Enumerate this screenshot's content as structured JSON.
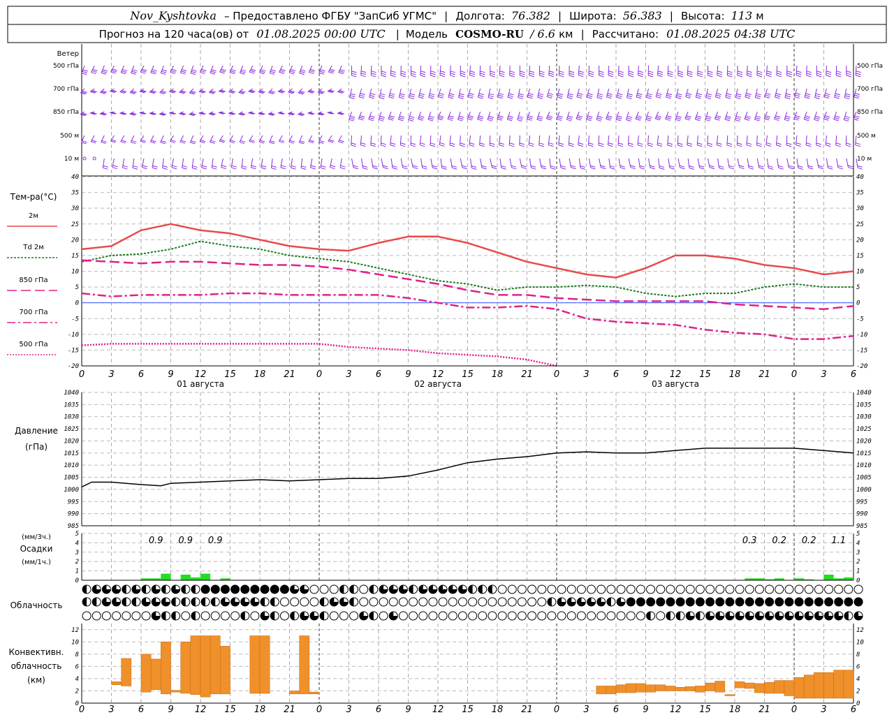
{
  "header": {
    "station": "Nov_Kyshtovka",
    "provider": "– Предоставлено ФГБУ \"ЗапСиб УГМС\"",
    "lon_label": "Долгота:",
    "lon_value": "76.382",
    "lat_label": "Широта:",
    "lat_value": "56.383",
    "alt_label": "Высота:",
    "alt_value": "113",
    "alt_unit": "м",
    "forecast_prefix": "Прогноз на 120 часа(ов) от",
    "forecast_time": "01.08.2025 00:00 UTC",
    "model_label": "Модель",
    "model_name": "COSMO-RU",
    "model_res": "/ 6.6",
    "model_res_unit": "км",
    "calc_label": "Рассчитано:",
    "calc_time": "01.08.2025 04:38 UTC"
  },
  "wind": {
    "title": "Ветер",
    "levels": [
      "500 гПа",
      "700 гПа",
      "850 гПа",
      "500 м",
      "10  м"
    ]
  },
  "time_axis": {
    "hour_labels": [
      "0",
      "3",
      "6",
      "9",
      "12",
      "15",
      "18",
      "21",
      "0",
      "3",
      "6",
      "9",
      "12",
      "15",
      "18",
      "21",
      "0",
      "3",
      "6",
      "9",
      "12",
      "15",
      "18",
      "21",
      "0",
      "3",
      "6"
    ],
    "days": [
      "01 августа",
      "02 августа",
      "03 августа"
    ]
  },
  "colors": {
    "t2m": "#e84a4a",
    "td2m": "#1a7a1a",
    "t850": "#e0208a",
    "t700": "#e0208a",
    "t500": "#e0208a",
    "wind": "#8a2be2",
    "precip": "#22dd22",
    "conv": "#f0902a",
    "zero_line": "#3050ff"
  },
  "chart_data": [
    {
      "type": "line",
      "title": "Тем-ра(°C)",
      "unit_hours": "x = часы от 01.08.2025 00:00 UTC",
      "ylim": [
        -20,
        40
      ],
      "yticks": [
        -20,
        -15,
        -10,
        -5,
        0,
        5,
        10,
        15,
        20,
        25,
        30,
        35,
        40
      ],
      "legend": [
        "2м",
        "Td  2м",
        "850 гПа",
        "700 гПа",
        "500 гПа"
      ],
      "series": [
        {
          "name": "2м",
          "x": [
            0,
            3,
            6,
            9,
            12,
            15,
            18,
            21,
            24,
            27,
            30,
            33,
            36,
            39,
            42,
            45,
            48,
            51,
            54,
            57,
            60,
            63,
            66,
            69,
            72,
            75,
            78
          ],
          "values": [
            17,
            18,
            23,
            25,
            23,
            22,
            20,
            18,
            17,
            16.5,
            19,
            21,
            21,
            19,
            16,
            13,
            11,
            9,
            8,
            11,
            15,
            15,
            14,
            12,
            11,
            9,
            10
          ]
        },
        {
          "name": "Td  2м",
          "x": [
            0,
            3,
            6,
            9,
            12,
            15,
            18,
            21,
            24,
            27,
            30,
            33,
            36,
            39,
            42,
            45,
            48,
            51,
            54,
            57,
            60,
            63,
            66,
            69,
            72,
            75,
            78
          ],
          "values": [
            13,
            15,
            15.5,
            17,
            19.5,
            18,
            17,
            15,
            14,
            13,
            11,
            9,
            7,
            6,
            4,
            5,
            5,
            5.5,
            5,
            3,
            2,
            3,
            3,
            5,
            6,
            5,
            5
          ]
        },
        {
          "name": "850 гПа",
          "x": [
            0,
            3,
            6,
            9,
            12,
            15,
            18,
            21,
            24,
            27,
            30,
            33,
            36,
            39,
            42,
            45,
            48,
            51,
            54,
            57,
            60,
            63,
            66,
            69,
            72,
            75,
            78
          ],
          "values": [
            13.5,
            13,
            12.5,
            13,
            13,
            12.5,
            12,
            12,
            11.5,
            10.5,
            9,
            7.5,
            6,
            4,
            2.5,
            2.5,
            1.5,
            1,
            0.5,
            0.5,
            0.5,
            0.5,
            -0.5,
            -1,
            -1.5,
            -2,
            -1
          ]
        },
        {
          "name": "700 гПа",
          "x": [
            0,
            3,
            6,
            9,
            12,
            15,
            18,
            21,
            24,
            27,
            30,
            33,
            36,
            39,
            42,
            45,
            48,
            51,
            54,
            57,
            60,
            63,
            66,
            69,
            72,
            75,
            78
          ],
          "values": [
            3,
            2,
            2.5,
            2.5,
            2.5,
            3,
            3,
            2.5,
            2.5,
            2.5,
            2.5,
            1.5,
            0,
            -1.5,
            -1.5,
            -1,
            -2,
            -5,
            -6,
            -6.5,
            -7,
            -8.5,
            -9.5,
            -10,
            -11.5,
            -11.5,
            -10.5
          ]
        },
        {
          "name": "500 гПа",
          "x": [
            0,
            3,
            6,
            9,
            12,
            15,
            18,
            21,
            24,
            27,
            30,
            33,
            36,
            39,
            42,
            45,
            48
          ],
          "values": [
            -13.5,
            -13,
            -13,
            -13,
            -13,
            -13,
            -13,
            -13,
            -13,
            -14,
            -14.5,
            -15,
            -16,
            -16.5,
            -17,
            -18,
            -21
          ]
        }
      ]
    },
    {
      "type": "line",
      "title": "Давление",
      "ylabel": "(гПа)",
      "ylim": [
        985,
        1040
      ],
      "yticks": [
        985,
        990,
        995,
        1000,
        1005,
        1010,
        1015,
        1020,
        1025,
        1030,
        1035,
        1040
      ],
      "series": [
        {
          "name": "Давление",
          "x": [
            0,
            1,
            3,
            6,
            8,
            9,
            12,
            15,
            18,
            21,
            24,
            27,
            30,
            33,
            36,
            39,
            42,
            45,
            48,
            51,
            54,
            57,
            60,
            63,
            66,
            69,
            72,
            75,
            78
          ],
          "values": [
            1001,
            1003,
            1003,
            1002,
            1001.5,
            1002.5,
            1003,
            1003.5,
            1004,
            1003.5,
            1004,
            1004.5,
            1004.5,
            1005.5,
            1008,
            1011,
            1012.5,
            1013.5,
            1015,
            1015.5,
            1015,
            1015,
            1016,
            1017,
            1017,
            1017,
            1017,
            1016,
            1015
          ]
        }
      ]
    },
    {
      "type": "bar",
      "title": "Осадки",
      "ylabel_top": "(мм/3ч.)",
      "ylabel_bottom": "(мм/1ч.)",
      "ylim": [
        0,
        5
      ],
      "yticks": [
        0,
        1,
        2,
        3,
        4,
        5
      ],
      "three_hour_labels": [
        {
          "x": 7.5,
          "label": "0.9"
        },
        {
          "x": 10.5,
          "label": "0.9"
        },
        {
          "x": 13.5,
          "label": "0.9"
        },
        {
          "x": 67.5,
          "label": "0.3"
        },
        {
          "x": 70.5,
          "label": "0.2"
        },
        {
          "x": 73.5,
          "label": "0.2"
        },
        {
          "x": 76.5,
          "label": "1.1"
        }
      ],
      "bars": [
        {
          "x": 6,
          "value": 0.2
        },
        {
          "x": 7,
          "value": 0.2
        },
        {
          "x": 8,
          "value": 0.7
        },
        {
          "x": 10,
          "value": 0.6
        },
        {
          "x": 11,
          "value": 0.3
        },
        {
          "x": 12,
          "value": 0.7
        },
        {
          "x": 14,
          "value": 0.2
        },
        {
          "x": 67,
          "value": 0.2
        },
        {
          "x": 68,
          "value": 0.2
        },
        {
          "x": 69,
          "value": 0.1
        },
        {
          "x": 70,
          "value": 0.2
        },
        {
          "x": 72,
          "value": 0.2
        },
        {
          "x": 73,
          "value": 0.1
        },
        {
          "x": 75,
          "value": 0.6
        },
        {
          "x": 76,
          "value": 0.2
        },
        {
          "x": 77,
          "value": 0.3
        }
      ]
    },
    {
      "type": "table",
      "title": "Облачность",
      "rows_note": "3 уровня, доля покрытия 0..1 для каждого часа 0..78",
      "rows": [
        [
          0.5,
          0.75,
          0.75,
          0.75,
          0.5,
          0.75,
          0.5,
          0.75,
          0.5,
          0.75,
          0.5,
          0.5,
          1,
          1,
          1,
          1,
          1,
          1,
          1,
          1,
          1,
          0.75,
          0.75,
          0,
          0,
          0,
          0.5,
          0.5,
          0,
          0.5,
          0.75,
          0.75,
          0.75,
          0.5,
          0.75,
          0.75,
          0.75,
          0.75,
          0.75,
          0.5,
          0.5,
          0.5,
          0,
          0,
          0,
          0,
          0,
          0,
          0,
          0,
          0,
          0,
          0,
          0,
          0,
          0,
          0,
          0,
          0,
          0,
          0,
          0,
          0,
          0,
          0,
          0,
          0,
          0,
          0,
          0,
          0,
          0,
          0,
          0,
          0,
          0,
          0,
          0,
          0
        ],
        [
          0.5,
          0.5,
          0.75,
          0.75,
          0.5,
          0.5,
          0.75,
          0.75,
          0.75,
          0.5,
          0.5,
          0.5,
          0.5,
          0.5,
          0.75,
          0.75,
          0.75,
          0.75,
          0.5,
          0.5,
          0,
          0,
          0,
          0,
          0.5,
          0.75,
          0.75,
          0.5,
          0,
          0,
          0,
          0,
          0,
          0,
          0,
          0,
          0,
          0,
          0,
          0,
          0,
          0,
          0,
          0,
          0,
          0,
          0,
          0.5,
          0.75,
          0.75,
          0.75,
          0.75,
          0.75,
          0.5,
          0.75,
          1,
          1,
          1,
          1,
          1,
          1,
          1,
          1,
          1,
          1,
          1,
          1,
          1,
          1,
          1,
          1,
          1,
          1,
          1,
          1,
          1,
          1,
          1,
          1
        ],
        [
          0,
          0,
          0,
          0,
          0,
          0,
          0,
          0.75,
          0.5,
          0.5,
          0,
          0.5,
          0,
          0,
          0,
          0,
          0.5,
          0,
          0.75,
          0.5,
          0,
          0.5,
          0.75,
          0.75,
          0.5,
          0,
          0,
          0,
          0.75,
          0.5,
          0,
          0.75,
          0,
          0,
          0,
          0,
          0,
          0,
          0,
          0,
          0,
          0,
          0,
          0,
          0,
          0,
          0,
          0,
          0,
          0,
          0,
          0,
          0,
          0,
          0,
          0,
          0,
          0.5,
          0,
          0.5,
          0.5,
          0.75,
          0.5,
          0.75,
          0.75,
          0.75,
          0.75,
          0.75,
          0.75,
          0.75,
          0.75,
          0.75,
          0.75,
          0.75,
          0.75,
          0.75,
          0.75,
          0.5,
          0.75
        ]
      ]
    },
    {
      "type": "bar",
      "title": "Конвективн. облачность",
      "ylabel": "(км)",
      "ylim": [
        0,
        13
      ],
      "yticks": [
        0,
        2,
        4,
        6,
        8,
        10,
        12
      ],
      "bars": [
        {
          "x": 3.5,
          "base": 3.0,
          "top": 3.5
        },
        {
          "x": 4.5,
          "base": 2.8,
          "top": 7.3
        },
        {
          "x": 6.5,
          "base": 1.8,
          "top": 8.0
        },
        {
          "x": 7.5,
          "base": 2.2,
          "top": 7.2
        },
        {
          "x": 8.5,
          "base": 1.5,
          "top": 10.0
        },
        {
          "x": 9.5,
          "base": 1.8,
          "top": 2.1
        },
        {
          "x": 10.5,
          "base": 1.6,
          "top": 10.0
        },
        {
          "x": 11.5,
          "base": 1.4,
          "top": 11.0
        },
        {
          "x": 12.5,
          "base": 1.0,
          "top": 11.0
        },
        {
          "x": 13.5,
          "base": 1.5,
          "top": 11.0
        },
        {
          "x": 14.5,
          "base": 1.5,
          "top": 9.3
        },
        {
          "x": 17.5,
          "base": 1.6,
          "top": 11.0
        },
        {
          "x": 18.5,
          "base": 1.6,
          "top": 11.0
        },
        {
          "x": 21.5,
          "base": 1.5,
          "top": 2.0
        },
        {
          "x": 22.5,
          "base": 1.5,
          "top": 11.0
        },
        {
          "x": 23.5,
          "base": 1.5,
          "top": 1.8
        },
        {
          "x": 52.5,
          "base": 1.5,
          "top": 2.8
        },
        {
          "x": 53.5,
          "base": 1.5,
          "top": 2.8
        },
        {
          "x": 54.5,
          "base": 1.7,
          "top": 3.0
        },
        {
          "x": 55.5,
          "base": 1.7,
          "top": 3.2
        },
        {
          "x": 56.5,
          "base": 1.8,
          "top": 3.2
        },
        {
          "x": 57.5,
          "base": 1.8,
          "top": 3.0
        },
        {
          "x": 58.5,
          "base": 2.0,
          "top": 3.0
        },
        {
          "x": 59.5,
          "base": 2.0,
          "top": 2.8
        },
        {
          "x": 60.5,
          "base": 2.0,
          "top": 2.6
        },
        {
          "x": 61.5,
          "base": 2.0,
          "top": 2.7
        },
        {
          "x": 62.5,
          "base": 1.8,
          "top": 2.8
        },
        {
          "x": 63.5,
          "base": 2.0,
          "top": 3.3
        },
        {
          "x": 64.5,
          "base": 1.8,
          "top": 3.6
        },
        {
          "x": 65.5,
          "base": 1.2,
          "top": 1.4
        },
        {
          "x": 66.5,
          "base": 2.5,
          "top": 3.5
        },
        {
          "x": 67.5,
          "base": 2.4,
          "top": 3.3
        },
        {
          "x": 68.5,
          "base": 1.7,
          "top": 3.2
        },
        {
          "x": 69.5,
          "base": 1.6,
          "top": 3.4
        },
        {
          "x": 70.5,
          "base": 1.6,
          "top": 3.7
        },
        {
          "x": 71.5,
          "base": 1.2,
          "top": 3.7
        },
        {
          "x": 72.5,
          "base": 0.8,
          "top": 4.2
        },
        {
          "x": 73.5,
          "base": 0.8,
          "top": 4.6
        },
        {
          "x": 74.5,
          "base": 0.8,
          "top": 5.0
        },
        {
          "x": 75.5,
          "base": 0.8,
          "top": 5.0
        },
        {
          "x": 76.5,
          "base": 0.8,
          "top": 5.4
        },
        {
          "x": 77.5,
          "base": 0.8,
          "top": 5.4
        }
      ]
    }
  ]
}
